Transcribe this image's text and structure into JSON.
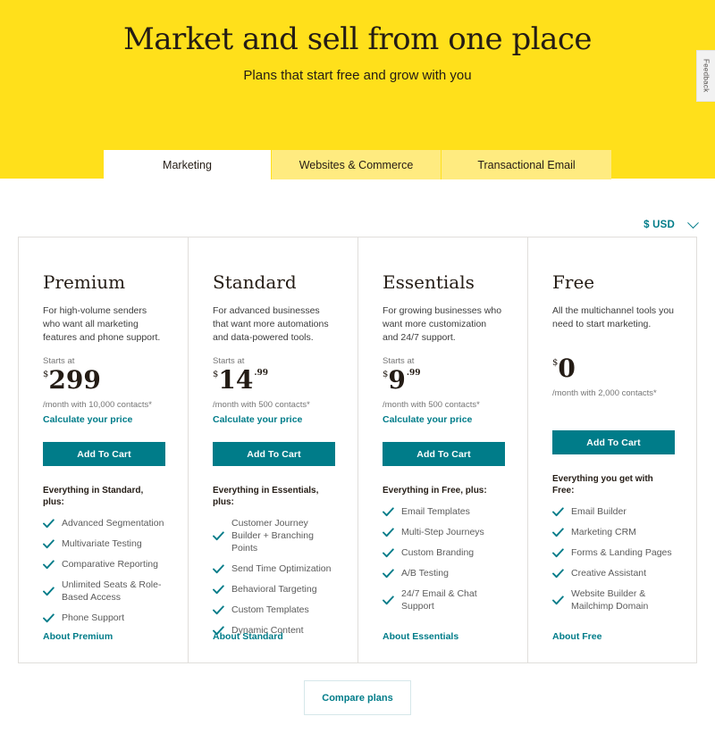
{
  "hero": {
    "title": "Market and sell from one place",
    "subtitle": "Plans that start free and grow with you",
    "background_color": "#FFE01B",
    "feedback_label": "Feedback"
  },
  "tabs": [
    {
      "label": "Marketing",
      "active": true
    },
    {
      "label": "Websites & Commerce",
      "active": false
    },
    {
      "label": "Transactional Email",
      "active": false
    }
  ],
  "currency": {
    "label": "$ USD",
    "icon": "chevron-down-icon",
    "color": "#007C89"
  },
  "theme": {
    "accent": "#007C89",
    "yellow": "#FFE01B",
    "tab_inactive": "#FFEB80",
    "border": "#E0DEDB",
    "text": "#241C15",
    "muted": "#767676"
  },
  "plans": [
    {
      "name": "Premium",
      "description": "For high-volume senders who want all marketing features and phone support.",
      "starts_at": "Starts at",
      "currency_symbol": "$",
      "price": "299",
      "cents": "",
      "price_note": "/month with 10,000 contacts*",
      "calculate_link": "Calculate your price",
      "cta": "Add To Cart",
      "features_header": "Everything in Standard, plus:",
      "features": [
        "Advanced Segmentation",
        "Multivariate Testing",
        "Comparative Reporting",
        "Unlimited Seats & Role-Based Access",
        "Phone Support"
      ],
      "about_link": "About Premium"
    },
    {
      "name": "Standard",
      "description": "For advanced businesses that want more automations and data-powered tools.",
      "starts_at": "Starts at",
      "currency_symbol": "$",
      "price": "14",
      "cents": ".99",
      "price_note": "/month with 500 contacts*",
      "calculate_link": "Calculate your price",
      "cta": "Add To Cart",
      "features_header": "Everything in Essentials, plus:",
      "features": [
        "Customer Journey Builder + Branching Points",
        "Send Time Optimization",
        "Behavioral Targeting",
        "Custom Templates",
        "Dynamic Content"
      ],
      "about_link": "About Standard"
    },
    {
      "name": "Essentials",
      "description": "For growing businesses who want more customization and 24/7 support.",
      "starts_at": "Starts at",
      "currency_symbol": "$",
      "price": "9",
      "cents": ".99",
      "price_note": "/month with 500 contacts*",
      "calculate_link": "Calculate your price",
      "cta": "Add To Cart",
      "features_header": "Everything in Free, plus:",
      "features": [
        "Email Templates",
        "Multi-Step Journeys",
        "Custom Branding",
        "A/B Testing",
        "24/7 Email & Chat Support"
      ],
      "about_link": "About Essentials"
    },
    {
      "name": "Free",
      "description": "All the multichannel tools you need to start marketing.",
      "starts_at": "",
      "currency_symbol": "$",
      "price": "0",
      "cents": "",
      "price_note": "/month with 2,000 contacts*",
      "calculate_link": "",
      "cta": "Add To Cart",
      "features_header": "Everything you get with Free:",
      "features": [
        "Email Builder",
        "Marketing CRM",
        "Forms & Landing Pages",
        "Creative Assistant",
        "Website Builder & Mailchimp Domain"
      ],
      "about_link": "About Free"
    }
  ],
  "footer": {
    "compare_label": "Compare plans"
  }
}
